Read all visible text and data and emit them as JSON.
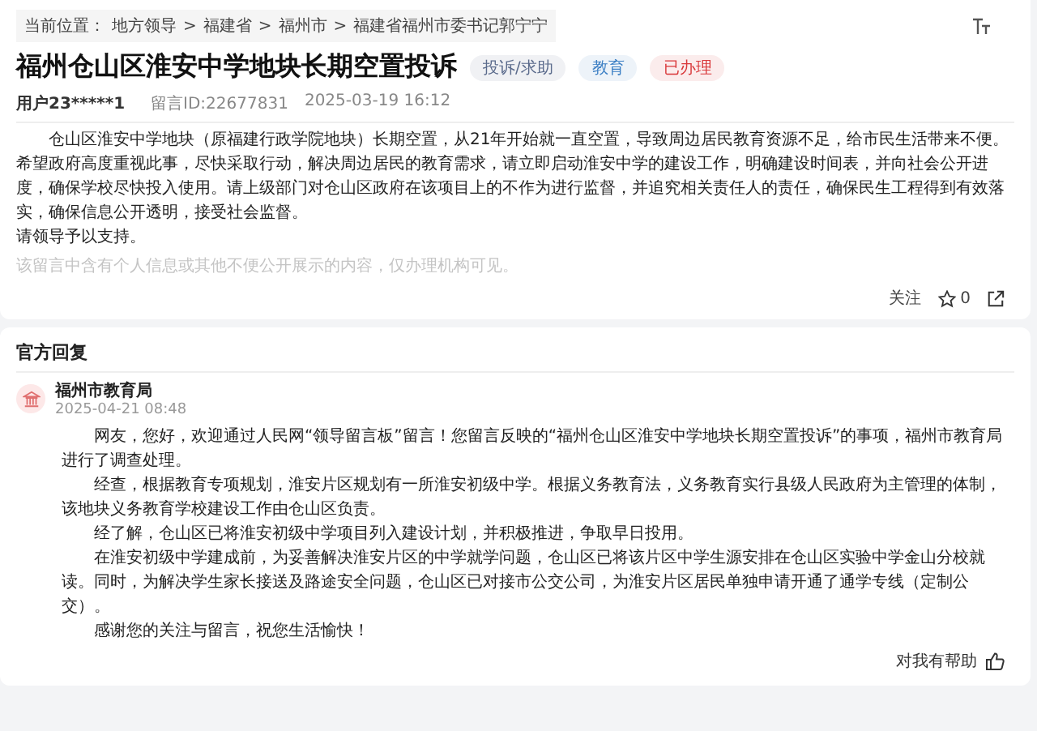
{
  "breadcrumb": {
    "label": "当前位置：",
    "items": [
      "地方领导",
      "福建省",
      "福州市",
      "福建省福州市委书记郭宁宁"
    ],
    "separator": ">"
  },
  "message": {
    "title": "福州仓山区淮安中学地块长期空置投诉",
    "tags": [
      {
        "label": "投诉/求助",
        "color": "#5b6b8c"
      },
      {
        "label": "教育",
        "color": "#3b7fc4"
      },
      {
        "label": "已办理",
        "color": "#d9383a"
      }
    ],
    "user": "用户23*****1",
    "id": "留言ID:22677831",
    "time": "2025-03-19 16:12",
    "paragraphs": [
      {
        "text": "仓山区淮安中学地块（原福建行政学院地块）长期空置，从21年开始就一直空置，导致周边居民教育资源不足，给市民生活带来不便。",
        "indent": true
      },
      {
        "text": "希望政府高度重视此事，尽快采取行动，解决周边居民的教育需求，请立即启动淮安中学的建设工作，明确建设时间表，并向社会公开进度，确保学校尽快投入使用。请上级部门对仓山区政府在该项目上的不作为进行监督，并追究相关责任人的责任，确保民生工程得到有效落实，确保信息公开透明，接受社会监督。",
        "indent": false
      },
      {
        "text": "请领导予以支持。",
        "indent": false
      }
    ],
    "privacy_note": "该留言中含有个人信息或其他不便公开展示的内容，仅办理机构可见。",
    "follow_label": "关注",
    "star_count": "0"
  },
  "reply": {
    "heading": "官方回复",
    "author": "福州市教育局",
    "time": "2025-04-21 08:48",
    "paragraphs": [
      "网友，您好，欢迎通过人民网“领导留言板”留言！您留言反映的“福州仓山区淮安中学地块长期空置投诉”的事项，福州市教育局进行了调查处理。",
      "经查，根据教育专项规划，淮安片区规划有一所淮安初级中学。根据义务教育法，义务教育实行县级人民政府为主管理的体制，该地块义务教育学校建设工作由仓山区负责。",
      "经了解，仓山区已将淮安初级中学项目列入建设计划，并积极推进，争取早日投用。",
      "在淮安初级中学建成前，为妥善解决淮安片区的中学就学问题，仓山区已将该片区中学生源安排在仓山区实验中学金山分校就读。同时，为解决学生家长接送及路途安全问题，仓山区已对接市公交公司，为淮安片区居民单独申请开通了通学专线（定制公交）。",
      "感谢您的关注与留言，祝您生活愉快！"
    ],
    "helpful_label": "对我有帮助"
  }
}
